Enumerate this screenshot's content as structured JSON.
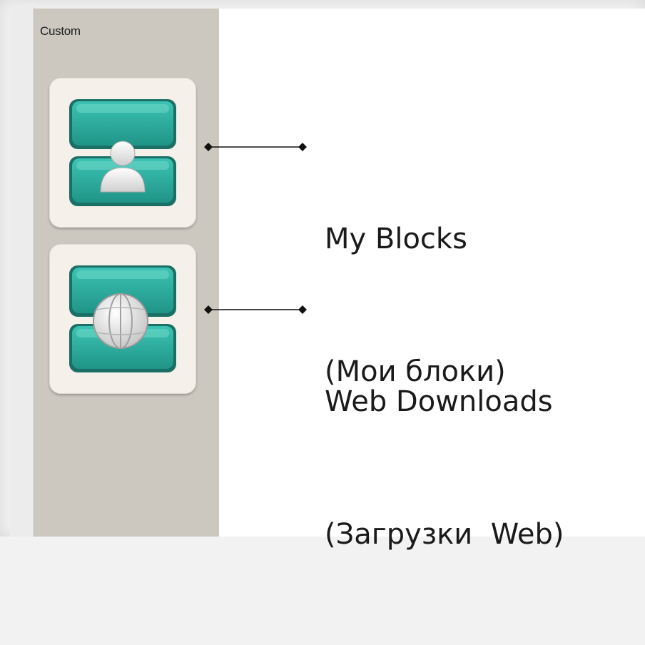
{
  "sidebar": {
    "title": "Custom",
    "items": [
      {
        "name": "My Blocks",
        "icon": "my-blocks-icon"
      },
      {
        "name": "Web Downloads",
        "icon": "web-downloads-icon"
      }
    ]
  },
  "callouts": [
    {
      "line1": "My Blocks",
      "line2": "(Мои блоки)"
    },
    {
      "line1": "Web Downloads",
      "line2": "(Загрузки  Web)"
    }
  ],
  "colors": {
    "block_teal": "#2aa89a",
    "block_teal_dark": "#1d7d72",
    "sidebar_bg": "#ccc8c0",
    "tile_bg": "#f5f1ea"
  }
}
